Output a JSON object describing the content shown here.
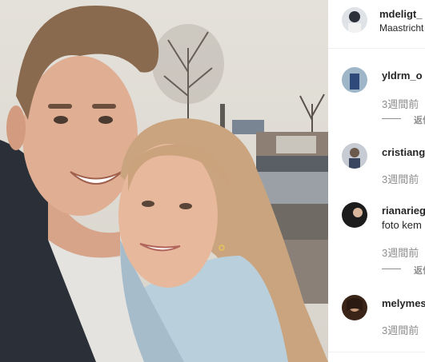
{
  "post": {
    "author": "mdeligt_",
    "location": "Maastricht"
  },
  "comments": [
    {
      "username": "yldrm_o",
      "time": "3週間前",
      "replies_label": "返信"
    },
    {
      "username": "cristiang",
      "time": "3週間前"
    },
    {
      "username": "rianarieg",
      "text": "foto kem",
      "time": "3週間前",
      "replies_label": "返信"
    },
    {
      "username": "melymes",
      "time": "3週間前"
    }
  ]
}
